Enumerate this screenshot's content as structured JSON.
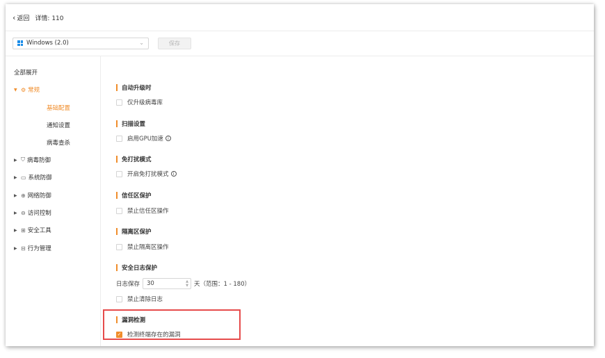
{
  "header": {
    "back_label": "返回",
    "detail_label": "详情: 110"
  },
  "toolbar": {
    "os_select": "Windows (2.0)",
    "save_label": "保存"
  },
  "sidebar": {
    "expand_all": "全部展开",
    "groups": [
      {
        "label": "常规",
        "icon": "gear-icon",
        "expanded": true
      },
      {
        "label": "病毒防御",
        "icon": "shield-icon"
      },
      {
        "label": "系统防御",
        "icon": "monitor-icon"
      },
      {
        "label": "网络防御",
        "icon": "globe-icon"
      },
      {
        "label": "访问控制",
        "icon": "lock-icon"
      },
      {
        "label": "安全工具",
        "icon": "grid-icon"
      },
      {
        "label": "行为管理",
        "icon": "list-icon"
      }
    ],
    "subitems": [
      "基础配置",
      "通知设置",
      "病毒查杀"
    ]
  },
  "sections": [
    {
      "title": "自动升级时",
      "option": "仅升级病毒库"
    },
    {
      "title": "扫描设置",
      "option": "启用GPU加速"
    },
    {
      "title": "免打扰模式",
      "option": "开启免打扰模式"
    },
    {
      "title": "信任区保护",
      "option": "禁止信任区操作"
    },
    {
      "title": "隔离区保护",
      "option": "禁止隔离区操作"
    },
    {
      "title": "安全日志保护",
      "option": "禁止清除日志"
    },
    {
      "title": "漏洞检测",
      "option": "检测终端存在的漏洞"
    }
  ],
  "log": {
    "label": "日志保存",
    "value": "30",
    "unit": "天（范围：1 - 180）"
  },
  "colors": {
    "accent": "#f08d2b",
    "highlight": "#e64b4b",
    "windows": "#1a8ce8"
  }
}
